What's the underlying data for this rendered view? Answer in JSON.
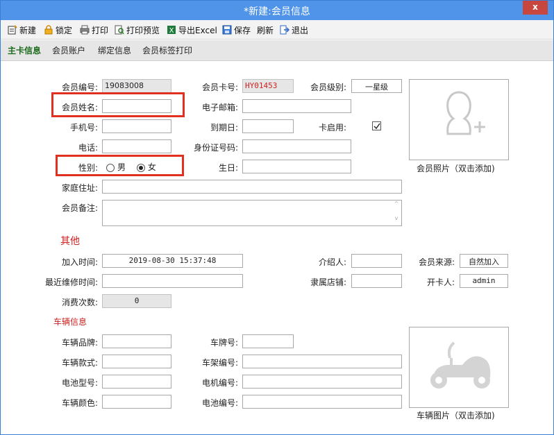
{
  "window": {
    "title": "*新建:会员信息",
    "close_label": "x"
  },
  "toolbar": {
    "new": "新建",
    "lock": "锁定",
    "print": "打印",
    "print_preview": "打印预览",
    "export_excel": "导出Excel",
    "save": "保存",
    "refresh": "刷新",
    "exit": "退出"
  },
  "tabs": [
    "主卡信息",
    "会员账户",
    "绑定信息",
    "会员标签打印"
  ],
  "member": {
    "labels": {
      "no": "会员编号:",
      "name": "会员姓名:",
      "mobile": "手机号:",
      "phone": "电话:",
      "gender": "性别:",
      "address": "家庭住址:",
      "remark": "会员备注:",
      "card_no": "会员卡号:",
      "email": "电子邮箱:",
      "expire": "到期日:",
      "id_no": "身份证号码:",
      "birthday": "生日:",
      "level": "会员级别:",
      "card_enabled": "卡启用:"
    },
    "values": {
      "no": "19083008",
      "name": "",
      "mobile": "",
      "phone": "",
      "address": "",
      "remark": "",
      "card_no": "HY01453",
      "email": "",
      "expire": "",
      "id_no": "",
      "birthday": "",
      "level": "一星级"
    },
    "gender_options": [
      "男",
      "女"
    ],
    "gender_selected": "女",
    "card_enabled": true,
    "photo_caption": "会员照片（双击添加)"
  },
  "other": {
    "title": "其他",
    "labels": {
      "join_time": "加入时间:",
      "last_repair": "最近维修时间:",
      "consume_count": "消费次数:",
      "referrer": "介绍人:",
      "store": "隶属店铺:",
      "source": "会员来源:",
      "opener": "开卡人:"
    },
    "values": {
      "join_time": "2019-08-30 15:37:48",
      "last_repair": "",
      "consume_count": "0",
      "referrer": "",
      "store": "",
      "source": "自然加入",
      "opener": "admin"
    }
  },
  "vehicle": {
    "title": "车辆信息",
    "labels": {
      "brand": "车辆品牌:",
      "model": "车辆款式:",
      "battery_model": "电池型号:",
      "color": "车辆颜色:",
      "plate": "车牌号:",
      "frame_no": "车架编号:",
      "motor_no": "电机编号:",
      "battery_no": "电池编号:"
    },
    "values": {
      "brand": "",
      "model": "",
      "battery_model": "",
      "color": "",
      "plate": "",
      "frame_no": "",
      "motor_no": "",
      "battery_no": ""
    },
    "photo_caption": "车辆图片（双击添加)"
  },
  "colors": {
    "title_bar": "#4f94e8",
    "highlight_box": "#e03020",
    "section_title": "#cc2020",
    "active_tab": "#1d6b1d"
  }
}
